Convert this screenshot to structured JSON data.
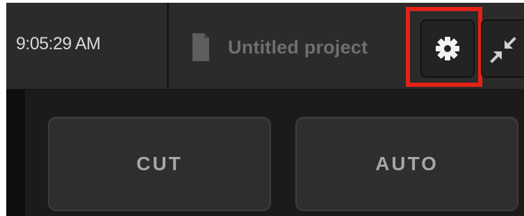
{
  "topbar": {
    "clock": "9:05:29 AM",
    "project_title": "Untitled project",
    "document_icon": "document-icon",
    "settings_icon": "gear-icon",
    "collapse_icon": "collapse-arrows-icon"
  },
  "transition": {
    "cut_label": "CUT",
    "auto_label": "AUTO"
  },
  "colors": {
    "highlight": "#e42216",
    "background": "#181818",
    "button": "#2e2e2e"
  }
}
